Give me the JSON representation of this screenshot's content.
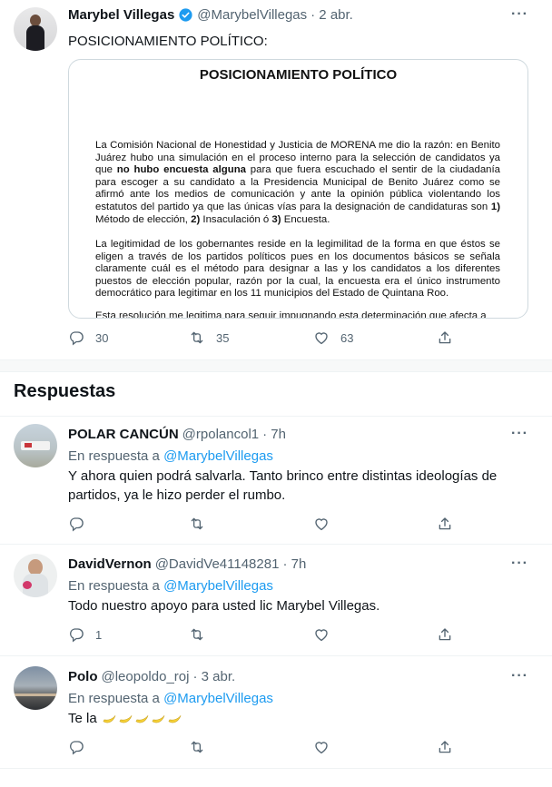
{
  "tweet": {
    "author_name": "Marybel Villegas",
    "handle": "@MarybelVillegas",
    "date": "· 2 abr.",
    "text": "POSICIONAMIENTO POLÍTICO:",
    "document": {
      "title": "POSICIONAMIENTO POLÍTICO",
      "p1_a": "La Comisión Nacional de Honestidad y Justicia de MORENA me dio la razón: en Benito Juárez hubo una simulación en el proceso interno para la selección de candidatos ya que ",
      "p1_bold1": "no hubo encuesta alguna",
      "p1_b": " para que fuera escuchado el sentir de la ciudadanía para escoger a su candidato a la Presidencia Municipal de Benito Juárez como se afirmó ante los medios de comunicación y ante la opinión pública violentando los estatutos del partido ya que las únicas vías para la designación de candidaturas son ",
      "p1_bold2": "1)",
      "p1_c": " Método de elección, ",
      "p1_bold3": "2)",
      "p1_d": " Insaculación ó ",
      "p1_bold4": "3)",
      "p1_e": " Encuesta.",
      "p2": "La legitimidad de los gobernantes reside en la legimilitad de la forma en que éstos se eligen a través de los partidos políticos pues en los documentos básicos se señala claramente cuál es el método para designar a las y los candidatos a los diferentes puestos de elección popular, razón por la cual, la encuesta era el único instrumento democrático para legitimar en los 11 municipios del Estado de Quintana Roo.",
      "p3": "Esta resolución me legitima para seguir impugnando esta determinación que afecta a"
    },
    "replies_count": "30",
    "retweets_count": "35",
    "likes_count": "63"
  },
  "section_title": "Respuestas",
  "replies": [
    {
      "name": "POLAR CANCÚN",
      "handle": "@rpolancol1",
      "date": "· 7h",
      "reply_prefix": "En respuesta a ",
      "reply_handle": "@MarybelVillegas",
      "text": "Y ahora quien podrá salvarla. Tanto brinco entre distintas ideologías de partidos, ya le hizo perder el rumbo.",
      "reply_count": ""
    },
    {
      "name": "DavidVernon",
      "handle": "@DavidVe41148281",
      "date": "· 7h",
      "reply_prefix": "En respuesta a ",
      "reply_handle": "@MarybelVillegas",
      "text": "Todo nuestro apoyo para usted lic Marybel Villegas.",
      "reply_count": "1"
    },
    {
      "name": "Polo",
      "handle": "@leopoldo_roj",
      "date": "· 3 abr.",
      "reply_prefix": "En respuesta a ",
      "reply_handle": "@MarybelVillegas",
      "text": "Te la",
      "reply_count": ""
    }
  ],
  "icons": {
    "verified": "verified-badge-icon",
    "more": "more-icon",
    "reply": "reply-icon",
    "retweet": "retweet-icon",
    "like": "like-icon",
    "share": "share-icon"
  },
  "colors": {
    "accent": "#1d9bf0",
    "secondary_text": "#536471",
    "primary_text": "#0f1419",
    "divider": "#eff3f4",
    "separator_band": "#f7f9f9"
  }
}
